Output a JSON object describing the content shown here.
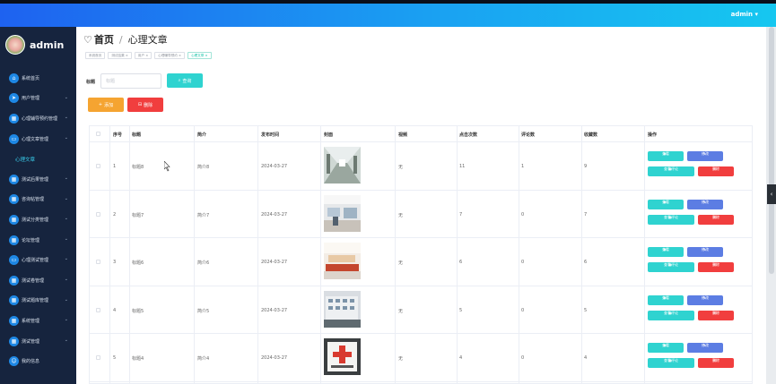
{
  "header": {
    "user_menu": "admin ▾"
  },
  "sidebar": {
    "brand": "admin",
    "items": [
      {
        "label": "系统首页",
        "icon": "home-icon"
      },
      {
        "label": "用户管理",
        "icon": "send-icon"
      },
      {
        "label": "心理辅导预约管理",
        "icon": "grid-icon"
      },
      {
        "label": "心理文章管理",
        "icon": "chat-icon"
      },
      {
        "label": "测试后果管理",
        "icon": "grid-icon"
      },
      {
        "label": "咨询帖管理",
        "icon": "grid-icon"
      },
      {
        "label": "测试分类管理",
        "icon": "grid-icon"
      },
      {
        "label": "论坛管理",
        "icon": "grid-icon"
      },
      {
        "label": "心理测试管理",
        "icon": "chat-icon"
      },
      {
        "label": "测试卷管理",
        "icon": "grid-icon"
      },
      {
        "label": "测试题库管理",
        "icon": "grid-icon"
      },
      {
        "label": "系统管理",
        "icon": "grid-icon"
      },
      {
        "label": "测试管理",
        "icon": "grid-icon"
      },
      {
        "label": "我的信息",
        "icon": "user-icon"
      }
    ],
    "active_sub": "心理文章"
  },
  "page": {
    "home": "首页",
    "current": "心理文章",
    "tags": [
      "系统首页",
      "测试结果 ×",
      "用户 ×",
      "心理辅导预约 ×",
      "心理文章 ×"
    ]
  },
  "search": {
    "label": "标题",
    "placeholder": "标题",
    "button": "查询"
  },
  "actions": {
    "add": "添加",
    "delete": "删除"
  },
  "table": {
    "headers": [
      "序号",
      "标题",
      "简介",
      "发布时间",
      "封面",
      "视频",
      "点击次数",
      "评论数",
      "收藏数",
      "操作"
    ],
    "rows": [
      {
        "idx": "1",
        "title": "标题8",
        "intro": "简介8",
        "date": "2024-03-27",
        "video": "无",
        "clicks": "11",
        "comments": "1",
        "favs": "9",
        "cover": "corridor"
      },
      {
        "idx": "2",
        "title": "标题7",
        "intro": "简介7",
        "date": "2024-03-27",
        "video": "无",
        "clicks": "7",
        "comments": "0",
        "favs": "7",
        "cover": "lobby"
      },
      {
        "idx": "3",
        "title": "标题6",
        "intro": "简介6",
        "date": "2024-03-27",
        "video": "无",
        "clicks": "6",
        "comments": "0",
        "favs": "6",
        "cover": "counter"
      },
      {
        "idx": "4",
        "title": "标题5",
        "intro": "简介5",
        "date": "2024-03-27",
        "video": "无",
        "clicks": "5",
        "comments": "0",
        "favs": "5",
        "cover": "building"
      },
      {
        "idx": "5",
        "title": "标题4",
        "intro": "简介4",
        "date": "2024-03-27",
        "video": "无",
        "clicks": "4",
        "comments": "0",
        "favs": "4",
        "cover": "sign"
      }
    ],
    "row_actions": {
      "view": "查看",
      "edit": "修改",
      "view_comments": "查看评论",
      "delete": "删除"
    }
  },
  "colors": {
    "accent": "#1e62f0",
    "sidebar": "#16243e",
    "cyan": "#2fd3d0",
    "blue": "#5c7de3",
    "red": "#f13e3e",
    "orange": "#f5a431"
  }
}
